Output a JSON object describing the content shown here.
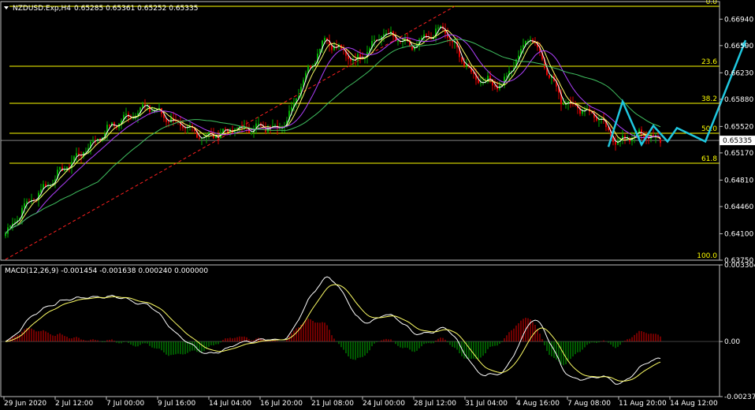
{
  "header": {
    "symbol": "NZDUSD.Exp,H4",
    "ohlc": "0.65285 0.65361 0.65252 0.65335"
  },
  "macd": {
    "label": "MACD(12,26,9) -0.001454 -0.001638 0.000240 0.000000",
    "ticks": [
      {
        "v": 0.003304,
        "text": "0.003304"
      },
      {
        "v": 0.0,
        "text": "0.00"
      },
      {
        "v": -0.002374,
        "text": "-0.002374"
      }
    ],
    "range": [
      -0.002374,
      0.003304
    ]
  },
  "price": {
    "range": [
      0.6375,
      0.6711
    ],
    "ticks": [
      "0.66940",
      "0.66590",
      "0.66230",
      "0.65880",
      "0.65520",
      "0.65170",
      "0.64810",
      "0.64460",
      "0.64100",
      "0.63750"
    ],
    "current": "0.65335",
    "current_value": 0.65335
  },
  "fibonacci": [
    {
      "label": "0.0",
      "price": 0.6711
    },
    {
      "label": "23.6",
      "price": 0.66317
    },
    {
      "label": "38.2",
      "price": 0.65827
    },
    {
      "label": "50.0",
      "price": 0.6543
    },
    {
      "label": "61.8",
      "price": 0.65033
    },
    {
      "label": "100.0",
      "price": 0.6375
    }
  ],
  "time_axis": [
    "29 Jun 2020",
    "2 Jul 12:00",
    "7 Jul 00:00",
    "9 Jul 16:00",
    "14 Jul 04:00",
    "16 Jul 20:00",
    "21 Jul 08:00",
    "24 Jul 00:00",
    "28 Jul 12:00",
    "31 Jul 04:00",
    "4 Aug 16:00",
    "7 Aug 08:00",
    "11 Aug 20:00",
    "14 Aug 12:00"
  ],
  "colors": {
    "bull": "#00b000",
    "bear": "#e00000",
    "fib": "#ffff00",
    "forecast": "#1fc8e0",
    "ma_fast": "#ffffff",
    "ma_mid": "#ffff66",
    "ma_slow": "#b040ff",
    "ma_long": "#40c060",
    "trend": "#ff2020"
  },
  "chart_data": {
    "type": "candlestick",
    "title": "NZDUSD.Exp,H4",
    "anchors": [
      {
        "i": 0,
        "p": 0.641
      },
      {
        "i": 8,
        "p": 0.6446
      },
      {
        "i": 25,
        "p": 0.6497
      },
      {
        "i": 45,
        "p": 0.6553
      },
      {
        "i": 60,
        "p": 0.6579
      },
      {
        "i": 75,
        "p": 0.6551
      },
      {
        "i": 85,
        "p": 0.6538
      },
      {
        "i": 96,
        "p": 0.6548
      },
      {
        "i": 118,
        "p": 0.6553
      },
      {
        "i": 125,
        "p": 0.6608
      },
      {
        "i": 135,
        "p": 0.6668
      },
      {
        "i": 148,
        "p": 0.6638
      },
      {
        "i": 160,
        "p": 0.6676
      },
      {
        "i": 172,
        "p": 0.6657
      },
      {
        "i": 185,
        "p": 0.6682
      },
      {
        "i": 198,
        "p": 0.6617
      },
      {
        "i": 210,
        "p": 0.6606
      },
      {
        "i": 222,
        "p": 0.6674
      },
      {
        "i": 235,
        "p": 0.6588
      },
      {
        "i": 250,
        "p": 0.6566
      },
      {
        "i": 258,
        "p": 0.6532
      },
      {
        "i": 268,
        "p": 0.6542
      },
      {
        "i": 277,
        "p": 0.65335
      }
    ],
    "forecast": [
      {
        "i": 255,
        "p": 0.6525
      },
      {
        "i": 261,
        "p": 0.6585
      },
      {
        "i": 269,
        "p": 0.6528
      },
      {
        "i": 274,
        "p": 0.6553
      },
      {
        "i": 280,
        "p": 0.6532
      },
      {
        "i": 284,
        "p": 0.655
      },
      {
        "i": 296,
        "p": 0.6532
      },
      {
        "i": 313,
        "p": 0.6666
      }
    ],
    "trendline": [
      {
        "i": 0,
        "p": 0.6376
      },
      {
        "i": 190,
        "p": 0.6711
      }
    ]
  }
}
